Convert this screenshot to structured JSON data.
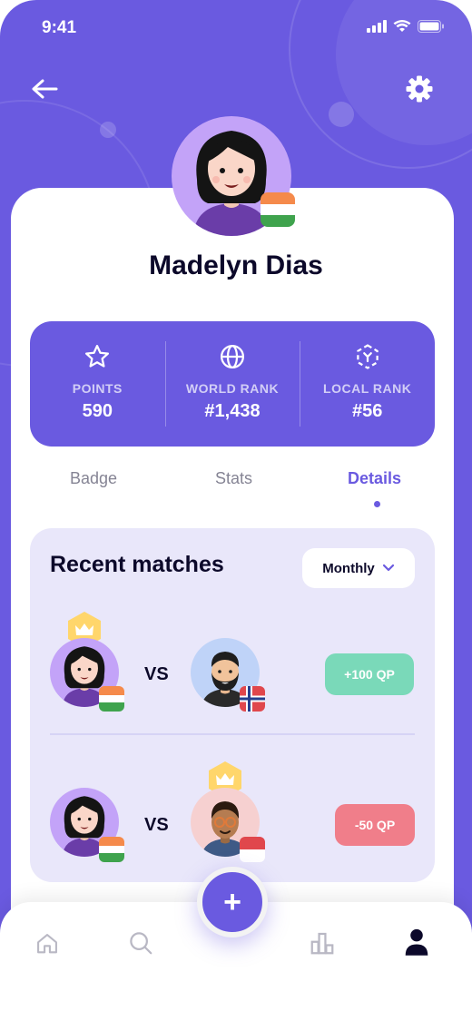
{
  "status_bar": {
    "time": "9:41"
  },
  "profile": {
    "name": "Madelyn Dias"
  },
  "stats": [
    {
      "icon": "star-icon",
      "label": "POINTS",
      "value": "590"
    },
    {
      "icon": "globe-icon",
      "label": "WORLD RANK",
      "value": "#1,438"
    },
    {
      "icon": "local-rank-icon",
      "label": "LOCAL RANK",
      "value": "#56"
    }
  ],
  "tabs": [
    {
      "label": "Badge",
      "active": false
    },
    {
      "label": "Stats",
      "active": false
    },
    {
      "label": "Details",
      "active": true
    }
  ],
  "recent_matches": {
    "title": "Recent matches",
    "filter": "Monthly",
    "matches": [
      {
        "vs_label": "VS",
        "result": "+100 QP",
        "result_color": "#7AD9B9",
        "winner": "player"
      },
      {
        "vs_label": "VS",
        "result": "-50 QP",
        "result_color": "#F07E8A",
        "winner": "opponent"
      }
    ]
  },
  "colors": {
    "primary": "#6A5AE0",
    "gain": "#7AD9B9",
    "loss": "#F07E8A",
    "crown": "#FFD66B"
  }
}
